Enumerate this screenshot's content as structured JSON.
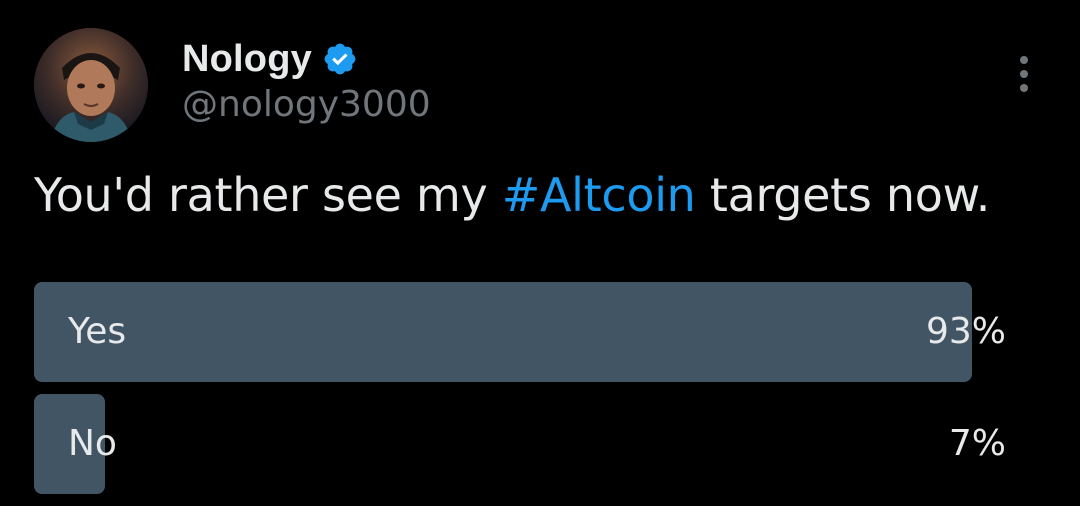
{
  "author": {
    "display_name": "Nology",
    "handle": "@nology3000",
    "verified": true,
    "avatar_icon": "profile-photo"
  },
  "tweet": {
    "text_before": "You'd rather see my ",
    "hashtag": "#Altcoin",
    "text_after": " targets now."
  },
  "poll": {
    "options": [
      {
        "label": "Yes",
        "percent_label": "93%",
        "percent": 93
      },
      {
        "label": "No",
        "percent_label": "7%",
        "percent": 7
      }
    ]
  },
  "colors": {
    "background": "#000000",
    "text": "#e7e9ea",
    "secondary_text": "#71767b",
    "accent": "#1d9bf0",
    "poll_bar": "#425565"
  },
  "icons": {
    "verified": "verified-badge-icon",
    "more": "more-vertical-icon"
  }
}
